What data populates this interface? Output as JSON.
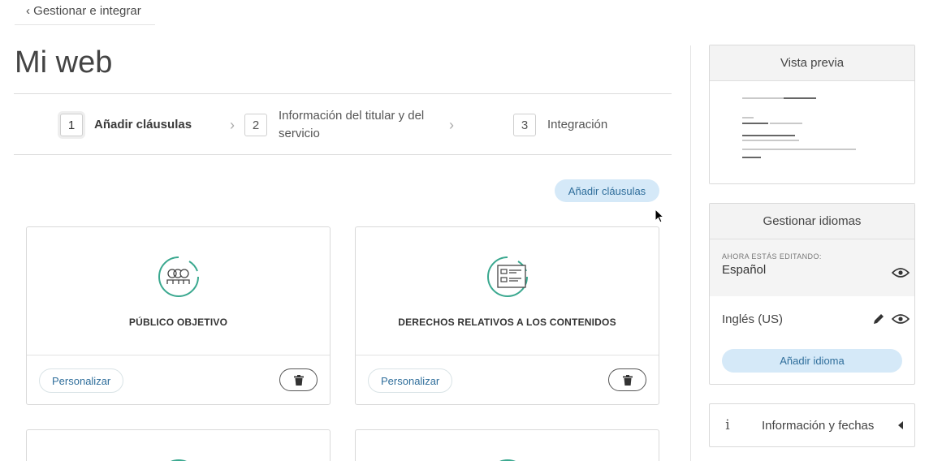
{
  "breadcrumb": {
    "label": "‹ Gestionar e integrar"
  },
  "page": {
    "title": "Mi web"
  },
  "stepper": {
    "steps": [
      {
        "num": "1",
        "label": "Añadir cláusulas"
      },
      {
        "num": "2",
        "label": "Información del titular y del servicio"
      },
      {
        "num": "3",
        "label": "Integración"
      }
    ],
    "separator": "›"
  },
  "toolbar": {
    "add_clauses_label": "Añadir cláusulas"
  },
  "cards": [
    {
      "title": "PÚBLICO OBJETIVO",
      "icon": "audience-icon",
      "customize_label": "Personalizar"
    },
    {
      "title": "DERECHOS RELATIVOS A LOS CONTENIDOS",
      "icon": "content-rights-icon",
      "customize_label": "Personalizar"
    }
  ],
  "sidebar": {
    "preview": {
      "title": "Vista previa"
    },
    "languages": {
      "title": "Gestionar idiomas",
      "editing_caption": "AHORA ESTÁS EDITANDO:",
      "current": "Español",
      "others": [
        "Inglés (US)"
      ],
      "add_label": "Añadir idioma"
    },
    "info": {
      "icon_glyph": "i",
      "label": "Información y fechas"
    }
  },
  "colors": {
    "accent_bg": "#d5e9f8",
    "accent_text": "#2f6e9b",
    "icon_teal": "#3aa88f"
  }
}
